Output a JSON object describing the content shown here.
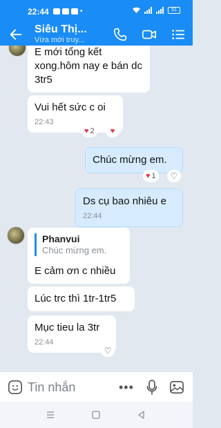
{
  "status": {
    "time": "22:44",
    "battery": "51"
  },
  "header": {
    "title": "Siêu Thị...",
    "subtitle": "Vừa mới truy..."
  },
  "messages": [
    {
      "side": "received",
      "text": "E mới tổng kết xong.hôm nay e bán dc 3tr5"
    },
    {
      "side": "received",
      "text": "Vui hết sức c oi",
      "time": "22:43",
      "reaction_count": "2"
    },
    {
      "side": "sent",
      "text": "Chúc mừng em.",
      "reaction_count": "1"
    },
    {
      "side": "sent",
      "text": "Ds cụ bao nhiêu e",
      "time": "22:44"
    },
    {
      "side": "received",
      "reply_to": {
        "name": "Phanvui",
        "text": "Chúc mừng em."
      },
      "text": "E cảm ơn c nhiều"
    },
    {
      "side": "received",
      "text": "Lúc trc thì 1tr-1tr5"
    },
    {
      "side": "received",
      "text": "Mục tieu la 3tr",
      "time": "22:44"
    }
  ],
  "input": {
    "placeholder": "Tin nhắn"
  },
  "icons": {
    "back": "arrow-left-icon",
    "call": "phone-icon",
    "video": "video-icon",
    "menu": "list-icon",
    "emoji": "emoji-icon",
    "more": "more-icon",
    "mic": "mic-icon",
    "image": "image-icon"
  },
  "colors": {
    "accent": "#1a8cf5",
    "sent_bubble": "#d6ecfe",
    "background": "#e2e8f0",
    "heart": "#e8334a"
  }
}
